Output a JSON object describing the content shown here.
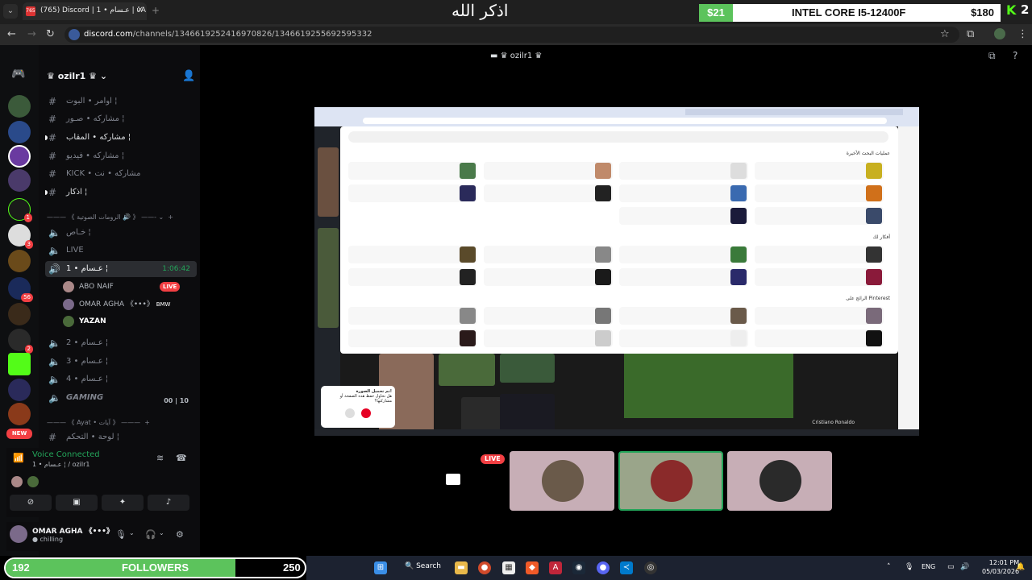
{
  "browser": {
    "tab_title": "(765) Discord | عـسام • 1 | ὐA",
    "tab_badge": "765",
    "url_host": "discord.com",
    "url_path": "/channels/1346619252416970826/1346619255692595332"
  },
  "overlay": {
    "dhikr": "اذكر الله",
    "pc_price_left": "$21",
    "pc_name": "INTEL CORE I5-12400F",
    "pc_price_right": "$180",
    "kick_count": "2"
  },
  "server": {
    "name": "ozilr1",
    "stream_title": "ozilr1"
  },
  "channels": [
    {
      "label": "اوامر • البوت ¦",
      "icon": "hash"
    },
    {
      "label": "مشاركه • صـور ¦",
      "icon": "hash"
    },
    {
      "label": "مشاركه • المقاب ¦",
      "icon": "hash",
      "bright": true
    },
    {
      "label": "مشاركه • فيديو ¦",
      "icon": "hash"
    },
    {
      "label": "KICK • مشاركه • نت",
      "icon": "hash"
    },
    {
      "label": "اذكار ¦",
      "icon": "hash",
      "bright": true
    }
  ],
  "category_voice": "《 الرومات الصوتية 🔊 》",
  "voice_channels": {
    "private": "خـاص ¦",
    "live": "LIVE",
    "active": "عـسام • 1 ¦",
    "active_timer": "1:06:42",
    "v2": "عـسام • 2 ¦",
    "v3": "عـسام • 3 ¦",
    "v4": "عـسام • 4 ¦",
    "gaming": "GAMING",
    "gaming_count": "00",
    "gaming_limit": "10"
  },
  "voice_users": [
    {
      "name": "ABO NAIF",
      "live": "LIVE"
    },
    {
      "name": "OMAR AGHA 《•••》",
      "tag": "BMW"
    },
    {
      "name": "YAZAN"
    }
  ],
  "category_ayat": "《 Ayat • آيات 》",
  "control_channel": "لوحة • التحكم ¦",
  "voice_panel": {
    "status": "Voice Connected",
    "channel": "عـسام • 1 ¦ / ozilr1"
  },
  "user_panel": {
    "name": "OMAR AGHA 《•••》",
    "status": "chilling"
  },
  "guild_badges": [
    "1",
    "3",
    "56",
    "2"
  ],
  "new_label": "NEW",
  "stream_live": "LIVE",
  "stream_content": {
    "recent_header": "عمليات البحث الأخيرة",
    "ideas_header": "أفكار لك",
    "trending_header": "الرائج على Pinterest",
    "popup_title": "تم تحميل الصورة!",
    "popup_body": "هل تحاول حفظ هذه الصفحة أو مشاركتها؟",
    "caption": "Cristiano Ronaldo"
  },
  "followers": {
    "current": "192",
    "label": "FOLLOWERS",
    "goal": "250",
    "progress": 0.768
  },
  "taskbar": {
    "search": "Search",
    "lang": "ENG",
    "time": "12:01 PM",
    "date": "05/03/2026"
  },
  "colors": {
    "accent_green": "#5cc35c",
    "discord_green": "#23a55a",
    "live_red": "#f23f43",
    "kick_green": "#53fc18"
  }
}
